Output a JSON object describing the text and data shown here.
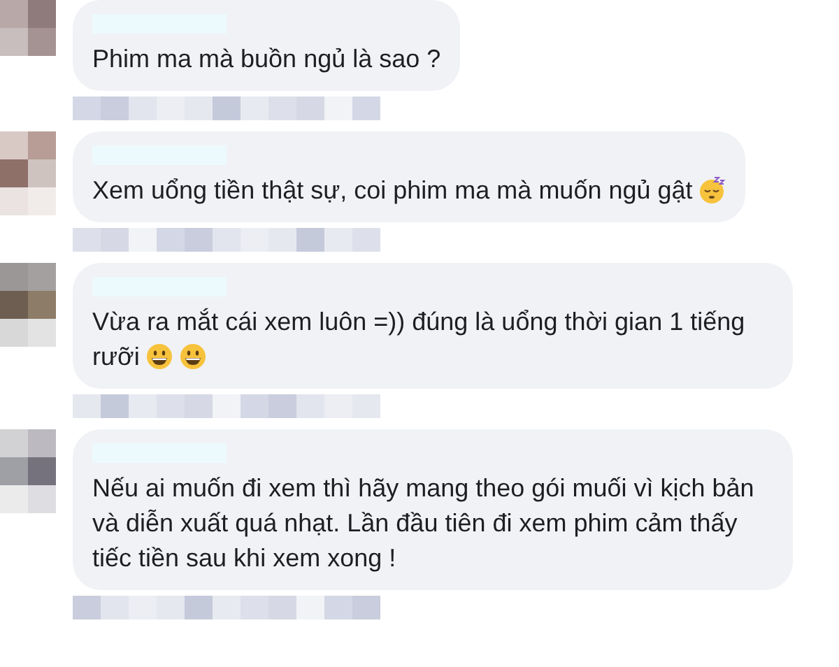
{
  "comments": [
    {
      "text": "Phim ma mà buồn ngủ là sao ?"
    },
    {
      "text": "Xem uổng tiền thật sự, coi phim ma mà muốn ngủ gật",
      "emojis": [
        {
          "kind": "sleepy"
        }
      ]
    },
    {
      "text": "Vừa ra mắt cái xem luôn =)) đúng là uổng thời gian 1 tiếng rưỡi",
      "emojis": [
        {
          "kind": "grin"
        },
        {
          "kind": "grin"
        }
      ]
    },
    {
      "text": "Nếu ai muốn đi xem thì hãy mang theo gói muối vì kịch bản và diễn xuất quá nhạt. Lần đầu tiên đi xem phim cảm thấy tiếc tiền sau khi xem xong !"
    }
  ]
}
